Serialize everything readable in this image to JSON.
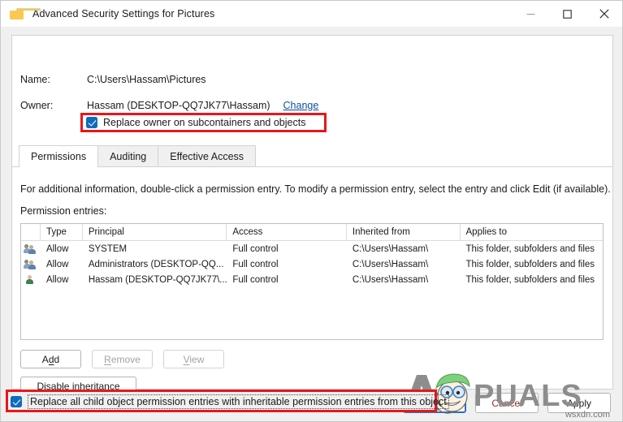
{
  "window": {
    "title": "Advanced Security Settings for Pictures",
    "folder_icon": "folder-icon",
    "caption": {
      "minimize": "minimize-icon",
      "maximize": "maximize-icon",
      "close": "close-icon"
    }
  },
  "header": {
    "name_label": "Name:",
    "name_value": "C:\\Users\\Hassam\\Pictures",
    "owner_label": "Owner:",
    "owner_value": "Hassam (DESKTOP-QQ7JK77\\Hassam)",
    "change_link": "Change",
    "replace_owner_checkbox": {
      "label": "Replace owner on subcontainers and objects",
      "checked": true
    }
  },
  "tabs": [
    {
      "label": "Permissions",
      "active": true
    },
    {
      "label": "Auditing",
      "active": false
    },
    {
      "label": "Effective Access",
      "active": false
    }
  ],
  "main": {
    "info_text": "For additional information, double-click a permission entry. To modify a permission entry, select the entry and click Edit (if available).",
    "entries_label": "Permission entries:",
    "table": {
      "columns": [
        "Type",
        "Principal",
        "Access",
        "Inherited from",
        "Applies to"
      ],
      "rows": [
        {
          "icon": "group-icon",
          "type": "Allow",
          "principal": "SYSTEM",
          "access": "Full control",
          "inherited_from": "C:\\Users\\Hassam\\",
          "applies_to": "This folder, subfolders and files"
        },
        {
          "icon": "group-icon",
          "type": "Allow",
          "principal": "Administrators (DESKTOP-QQ...",
          "access": "Full control",
          "inherited_from": "C:\\Users\\Hassam\\",
          "applies_to": "This folder, subfolders and files"
        },
        {
          "icon": "user-icon",
          "type": "Allow",
          "principal": "Hassam (DESKTOP-QQ7JK77\\...",
          "access": "Full control",
          "inherited_from": "C:\\Users\\Hassam\\",
          "applies_to": "This folder, subfolders and files"
        }
      ]
    },
    "buttons": {
      "add": "Add",
      "add_accel": "d",
      "remove": "Remove",
      "remove_enabled": false,
      "view": "View",
      "view_enabled": false,
      "disable_inheritance": "Disable inheritance"
    },
    "replace_child_checkbox": {
      "label": "Replace all child object permission entries with inheritable permission entries from this object",
      "checked": true
    }
  },
  "footer": {
    "ok": "OK",
    "cancel": "Cancel",
    "apply": "Apply"
  },
  "watermark": {
    "brand": "PUALS",
    "brand_prefix": "A",
    "site": "wsxdn.com"
  },
  "colors": {
    "accent": "#0f6cbd",
    "highlight_box": "#e8171b",
    "link": "#0b4f9e",
    "window_bg": "#f0f0f0"
  }
}
